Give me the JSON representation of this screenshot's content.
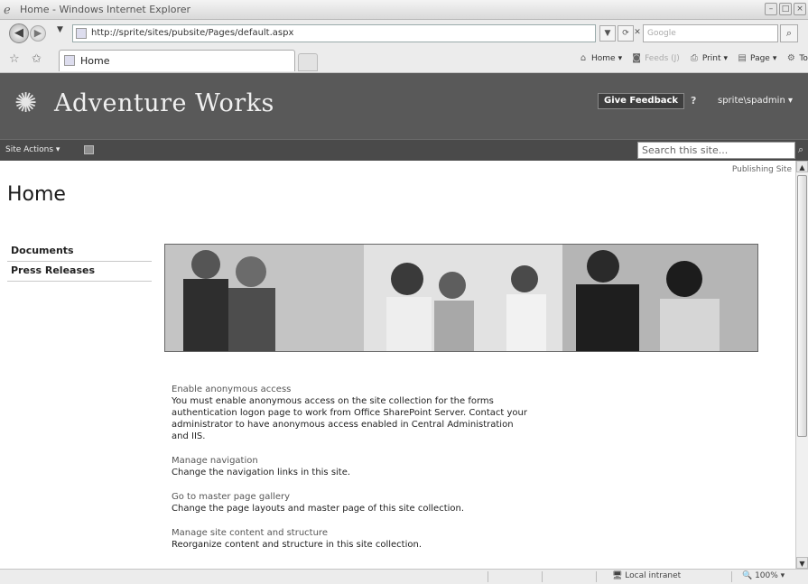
{
  "window": {
    "title": "Home - Windows Internet Explorer",
    "buttons": [
      "minimize",
      "maximize",
      "close"
    ]
  },
  "address_bar": {
    "url": "http://sprite/sites/pubsite/Pages/default.aspx",
    "search_placeholder": "Google"
  },
  "tabs": [
    {
      "label": "Home"
    }
  ],
  "command_bar": {
    "home": "Home",
    "feeds": "Feeds (J)",
    "print": "Print",
    "page": "Page",
    "tools": "Tools"
  },
  "site": {
    "title": "Adventure Works",
    "feedback_button": "Give Feedback",
    "help": "?",
    "user": "sprite\\spadmin",
    "site_actions": "Site Actions",
    "search_placeholder": "Search this site..."
  },
  "page": {
    "publishing_label": "Publishing Site",
    "title": "Home"
  },
  "quick_launch": [
    {
      "label": "Documents"
    },
    {
      "label": "Press Releases"
    }
  ],
  "banner": {
    "description": "Photo collage of business professionals"
  },
  "links": [
    {
      "title": "Enable anonymous access",
      "description": "You must enable anonymous access on the site collection for the forms authentication logon page to work from Office SharePoint Server. Contact your administrator to have anonymous access enabled in Central Administration and IIS."
    },
    {
      "title": "Manage navigation",
      "description": "Change the navigation links in this site."
    },
    {
      "title": "Go to master page gallery",
      "description": "Change the page layouts and master page of this site collection."
    },
    {
      "title": "Manage site content and structure",
      "description": "Reorganize content and structure in this site collection."
    }
  ],
  "status_bar": {
    "zone": "Local intranet",
    "zoom": "100%"
  },
  "colors": {
    "header_bg": "#595959",
    "topnav_bg": "#4a4a4a",
    "feedback_bg": "#3e3e3e"
  }
}
